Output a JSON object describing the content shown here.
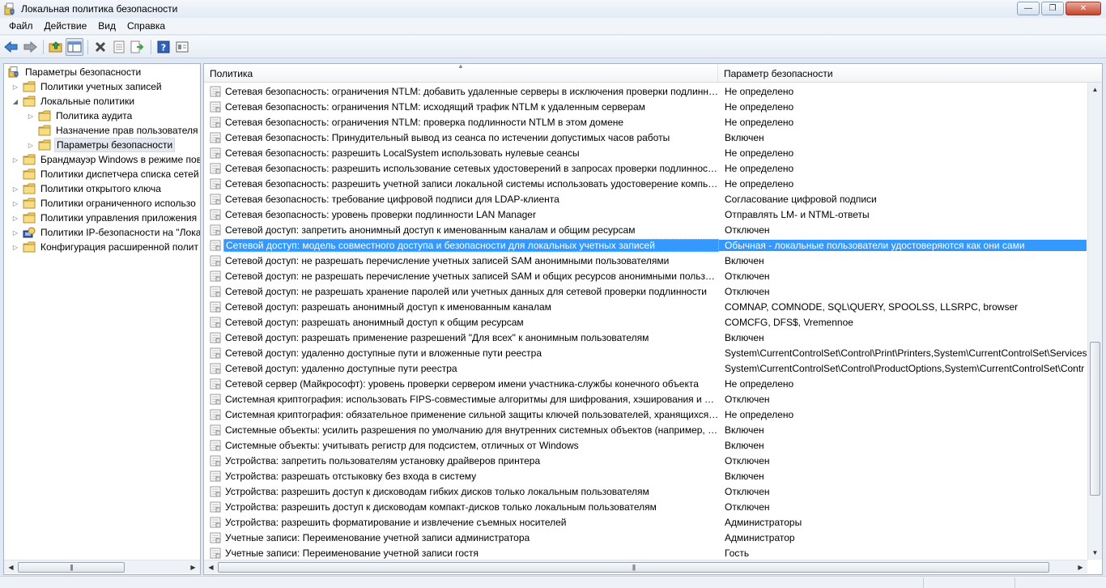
{
  "window": {
    "title": "Локальная политика безопасности",
    "buttons": {
      "minimize": "—",
      "maximize": "❐",
      "close": "✕"
    }
  },
  "menu": [
    "Файл",
    "Действие",
    "Вид",
    "Справка"
  ],
  "toolbar": [
    "back-arrow-icon",
    "forward-arrow-icon",
    "up-folder-icon",
    "show-hide-tree-icon",
    "delete-icon",
    "properties-icon",
    "export-icon",
    "help-icon",
    "view-icon"
  ],
  "tree": [
    {
      "label": "Параметры безопасности",
      "level": 0,
      "expander": "",
      "icon": "security-settings-icon"
    },
    {
      "label": "Политики учетных записей",
      "level": 1,
      "expander": "▷",
      "icon": "folder-icon"
    },
    {
      "label": "Локальные политики",
      "level": 1,
      "expander": "◢",
      "icon": "folder-icon"
    },
    {
      "label": "Политика аудита",
      "level": 2,
      "expander": "▷",
      "icon": "folder-icon"
    },
    {
      "label": "Назначение прав пользователя",
      "level": 2,
      "expander": "",
      "icon": "folder-icon"
    },
    {
      "label": "Параметры безопасности",
      "level": 2,
      "expander": "▷",
      "icon": "folder-icon",
      "selected": true
    },
    {
      "label": "Брандмауэр Windows в режиме пов",
      "level": 1,
      "expander": "▷",
      "icon": "folder-icon"
    },
    {
      "label": "Политики диспетчера списка сетей",
      "level": 1,
      "expander": "",
      "icon": "folder-icon"
    },
    {
      "label": "Политики открытого ключа",
      "level": 1,
      "expander": "▷",
      "icon": "folder-icon"
    },
    {
      "label": "Политики ограниченного использо",
      "level": 1,
      "expander": "▷",
      "icon": "folder-icon"
    },
    {
      "label": "Политики управления приложения",
      "level": 1,
      "expander": "▷",
      "icon": "folder-icon"
    },
    {
      "label": "Политики IP-безопасности на \"Лока",
      "level": 1,
      "expander": "▷",
      "icon": "ip-security-icon"
    },
    {
      "label": "Конфигурация расширенной полит",
      "level": 1,
      "expander": "▷",
      "icon": "folder-icon"
    }
  ],
  "list": {
    "columns": [
      "Политика",
      "Параметр безопасности"
    ],
    "rows": [
      {
        "policy": "Сетевая безопасность: ограничения NTLM: добавить удаленные серверы в исключения проверки подлинно…",
        "value": "Не определено"
      },
      {
        "policy": "Сетевая безопасность: ограничения NTLM: исходящий трафик NTLM к удаленным серверам",
        "value": "Не определено"
      },
      {
        "policy": "Сетевая безопасность: ограничения NTLM: проверка подлинности NTLM в этом домене",
        "value": "Не определено"
      },
      {
        "policy": "Сетевая безопасность: Принудительный вывод из сеанса по истечении допустимых часов работы",
        "value": "Включен"
      },
      {
        "policy": "Сетевая безопасность: разрешить LocalSystem использовать нулевые сеансы",
        "value": "Не определено"
      },
      {
        "policy": "Сетевая безопасность: разрешить использование сетевых удостоверений в запросах проверки подлинности…",
        "value": "Не определено"
      },
      {
        "policy": "Сетевая безопасность: разрешить учетной записи локальной системы использовать удостоверение компью…",
        "value": "Не определено"
      },
      {
        "policy": "Сетевая безопасность: требование цифровой подписи для LDAP-клиента",
        "value": "Согласование цифровой подписи"
      },
      {
        "policy": "Сетевая безопасность: уровень проверки подлинности LAN Manager",
        "value": "Отправлять LM- и NTML-ответы"
      },
      {
        "policy": "Сетевой доступ: запретить анонимный доступ к именованным каналам и общим ресурсам",
        "value": "Отключен"
      },
      {
        "policy": "Сетевой доступ: модель совместного доступа и безопасности для локальных учетных записей",
        "value": "Обычная - локальные пользователи удостоверяются как они сами",
        "selected": true
      },
      {
        "policy": "Сетевой доступ: не разрешать перечисление учетных записей SAM анонимными пользователями",
        "value": "Включен"
      },
      {
        "policy": "Сетевой доступ: не разрешать перечисление учетных записей SAM и общих ресурсов анонимными пользов…",
        "value": "Отключен"
      },
      {
        "policy": "Сетевой доступ: не разрешать хранение паролей или учетных данных для сетевой проверки подлинности",
        "value": "Отключен"
      },
      {
        "policy": "Сетевой доступ: разрешать анонимный доступ к именованным каналам",
        "value": "COMNAP, COMNODE, SQL\\QUERY, SPOOLSS, LLSRPC, browser"
      },
      {
        "policy": "Сетевой доступ: разрешать анонимный доступ к общим ресурсам",
        "value": "COMCFG, DFS$, Vremennoe"
      },
      {
        "policy": "Сетевой доступ: разрешать применение разрешений \"Для всех\" к анонимным пользователям",
        "value": "Включен"
      },
      {
        "policy": "Сетевой доступ: удаленно доступные пути и вложенные пути реестра",
        "value": "System\\CurrentControlSet\\Control\\Print\\Printers,System\\CurrentControlSet\\Services\\"
      },
      {
        "policy": "Сетевой доступ: удаленно доступные пути реестра",
        "value": "System\\CurrentControlSet\\Control\\ProductOptions,System\\CurrentControlSet\\Contr"
      },
      {
        "policy": "Сетевой сервер (Майкрософт): уровень проверки сервером имени участника-службы конечного объекта",
        "value": "Не определено"
      },
      {
        "policy": "Системная криптография: использовать FIPS-совместимые алгоритмы для шифрования, хэширования и по…",
        "value": "Отключен"
      },
      {
        "policy": "Системная криптография: обязательное применение сильной защиты ключей пользователей, хранящихся …",
        "value": "Не определено"
      },
      {
        "policy": "Системные объекты: усилить разрешения по умолчанию для внутренних системных объектов (например, с…",
        "value": "Включен"
      },
      {
        "policy": "Системные объекты: учитывать регистр для подсистем, отличных от Windows",
        "value": "Включен"
      },
      {
        "policy": "Устройства: запретить пользователям установку драйверов принтера",
        "value": "Отключен"
      },
      {
        "policy": "Устройства: разрешать отстыковку без входа в систему",
        "value": "Включен"
      },
      {
        "policy": "Устройства: разрешить доступ к дисководам гибких дисков только локальным пользователям",
        "value": "Отключен"
      },
      {
        "policy": "Устройства: разрешить доступ к дисководам компакт-дисков только локальным пользователям",
        "value": "Отключен"
      },
      {
        "policy": "Устройства: разрешить форматирование и извлечение съемных носителей",
        "value": "Администраторы"
      },
      {
        "policy": "Учетные записи: Переименование учетной записи администратора",
        "value": "Администратор"
      },
      {
        "policy": "Учетные записи: Переименование учетной записи гостя",
        "value": "Гость"
      }
    ]
  },
  "colors": {
    "selection": "#3399ff",
    "tree_selection": "#e5e9ef"
  }
}
